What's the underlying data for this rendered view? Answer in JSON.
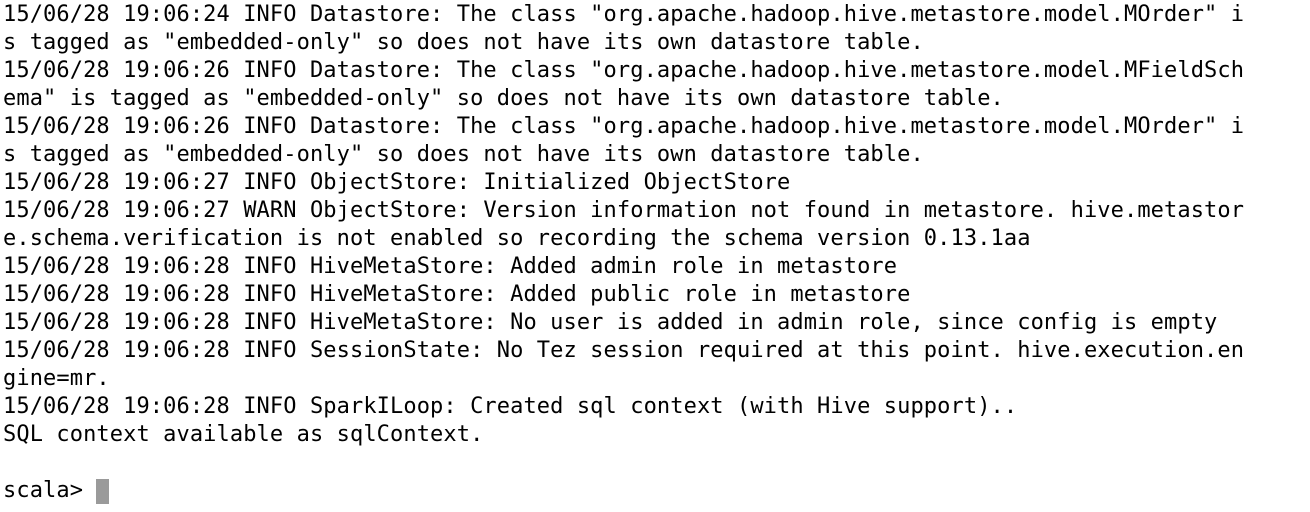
{
  "terminal": {
    "lines": [
      "15/06/28 19:06:24 INFO Datastore: The class \"org.apache.hadoop.hive.metastore.model.MOrder\" i",
      "s tagged as \"embedded-only\" so does not have its own datastore table.",
      "15/06/28 19:06:26 INFO Datastore: The class \"org.apache.hadoop.hive.metastore.model.MFieldSch",
      "ema\" is tagged as \"embedded-only\" so does not have its own datastore table.",
      "15/06/28 19:06:26 INFO Datastore: The class \"org.apache.hadoop.hive.metastore.model.MOrder\" i",
      "s tagged as \"embedded-only\" so does not have its own datastore table.",
      "15/06/28 19:06:27 INFO ObjectStore: Initialized ObjectStore",
      "15/06/28 19:06:27 WARN ObjectStore: Version information not found in metastore. hive.metastor",
      "e.schema.verification is not enabled so recording the schema version 0.13.1aa",
      "15/06/28 19:06:28 INFO HiveMetaStore: Added admin role in metastore",
      "15/06/28 19:06:28 INFO HiveMetaStore: Added public role in metastore",
      "15/06/28 19:06:28 INFO HiveMetaStore: No user is added in admin role, since config is empty",
      "15/06/28 19:06:28 INFO SessionState: No Tez session required at this point. hive.execution.en",
      "gine=mr.",
      "15/06/28 19:06:28 INFO SparkILoop: Created sql context (with Hive support)..",
      "SQL context available as sqlContext.",
      ""
    ],
    "prompt": "scala>",
    "cursor_color": "#9a9a9a"
  }
}
